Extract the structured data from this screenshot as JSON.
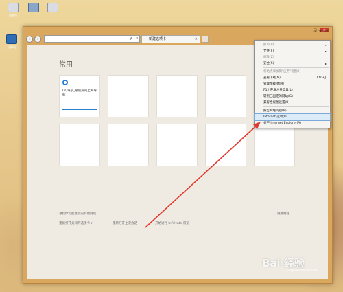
{
  "desktop": {
    "icons": [
      {
        "label": "回收站"
      },
      {
        "label": ""
      },
      {
        "label": ""
      },
      {
        "label": "计算机"
      }
    ]
  },
  "window": {
    "tab_title": "新建选项卡",
    "address_text": "",
    "address_tools": "ρ - c",
    "caption": {
      "minimize": "–",
      "maximize": "□",
      "close": "✕"
    },
    "right_tools": [
      "⌂",
      "★",
      "⚙"
    ]
  },
  "newtab_page": {
    "heading": "常用",
    "first_tile_title": "QQ导航_最权威的上网导航",
    "discover_text": "寻找你可能喜欢的其他网站",
    "hide_text": "隐藏网站",
    "reopen_closed": "重新打开关闭的选项卡 ▾",
    "reopen_session": "重新打开上次会话",
    "inprivate": "开始进行 InPrivate 浏览"
  },
  "menu": {
    "items": [
      {
        "label": "打印(P)",
        "disabled": true,
        "arrow": "▸"
      },
      {
        "label": "文件(F)",
        "disabled": false,
        "arrow": "▸"
      },
      {
        "label": "缩放(Z)",
        "disabled": true,
        "arrow": ""
      },
      {
        "label": "安全(S)",
        "disabled": false,
        "arrow": "▸"
      },
      {
        "sep": true
      },
      {
        "label": "将站点添加到\"应用\"视图(I)",
        "disabled": true
      },
      {
        "label": "查看下载(N)",
        "disabled": false,
        "shortcut": "Ctrl+J"
      },
      {
        "label": "管理加载项(M)",
        "disabled": false
      },
      {
        "label": "F12 开发人员工具(L)",
        "disabled": false
      },
      {
        "label": "转到已固定的网站(G)",
        "disabled": false
      },
      {
        "label": "兼容性视图设置(B)",
        "disabled": false
      },
      {
        "sep": true
      },
      {
        "label": "报告网站问题(R)",
        "disabled": false
      },
      {
        "label": "Internet 选项(O)",
        "disabled": false,
        "highlighted": true
      },
      {
        "label": "关于 Internet Explorer(A)",
        "disabled": false
      }
    ]
  },
  "watermark": {
    "brand": "Bai 经验",
    "sub": "jingyan.baidu.com"
  },
  "annotation_color": "#e03a2f"
}
